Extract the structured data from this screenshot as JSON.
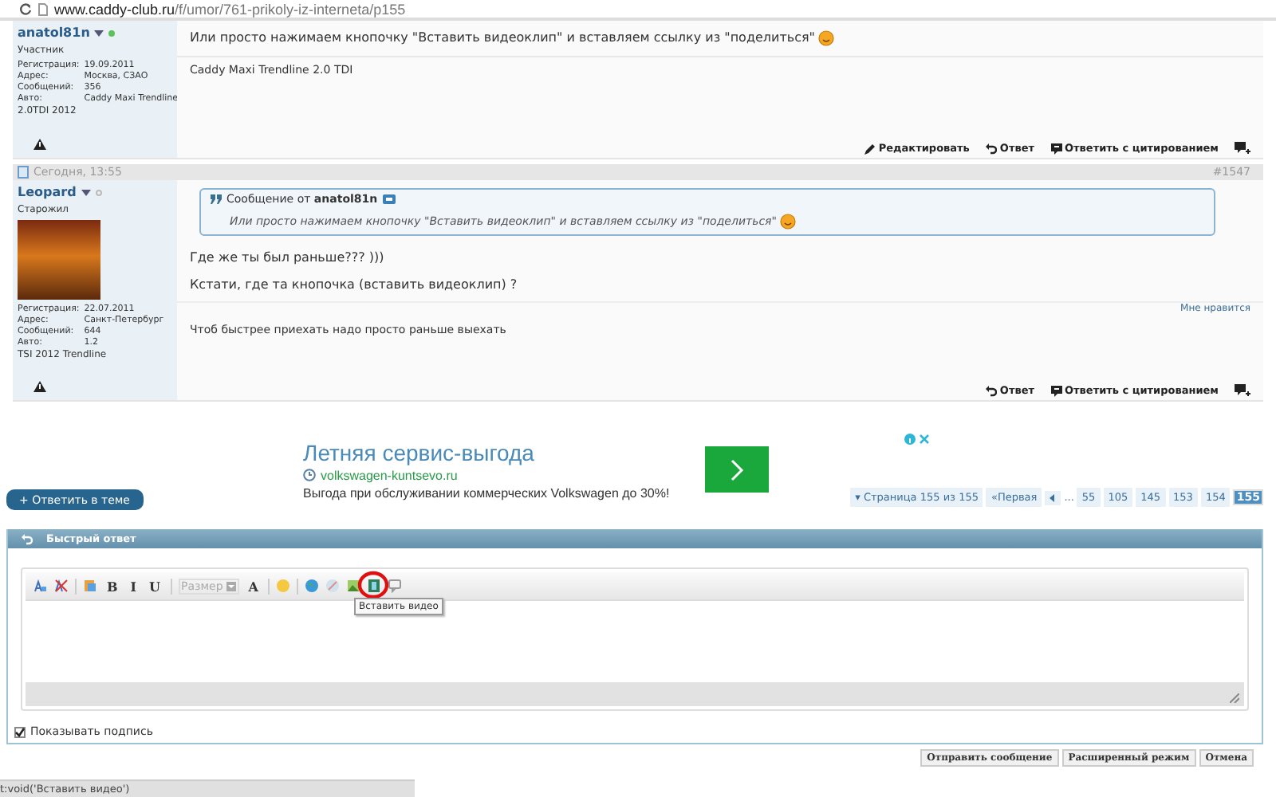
{
  "address_bar": {
    "domain": "www.caddy-club.ru",
    "path": "/f/umor/761-prikoly-iz-interneta/p155"
  },
  "posts": [
    {
      "user": {
        "name": "anatol81n",
        "online": true,
        "rank": "Участник",
        "has_avatar": false,
        "fields": [
          {
            "label": "Регистрация:",
            "value": "19.09.2011"
          },
          {
            "label": "Адрес:",
            "value": "Москва, СЗАО"
          },
          {
            "label": "Сообщений:",
            "value": "356"
          },
          {
            "label": "Авто:",
            "value": "Caddy Maxi Trendline"
          }
        ],
        "extra": "2.0TDI 2012"
      },
      "paragraphs": [
        "Или просто нажимаем кнопочку \"Вставить видеоклип\" и вставляем ссылку из \"поделиться\""
      ],
      "smiley": true,
      "signature": "Caddy Maxi Trendline 2.0 TDI",
      "actions": [
        {
          "kind": "edit",
          "label": "Редактировать"
        },
        {
          "kind": "reply",
          "label": "Ответ"
        },
        {
          "kind": "quote",
          "label": "Ответить с цитированием"
        }
      ]
    },
    {
      "date": "Сегодня, 13:55",
      "number": "#1547",
      "user": {
        "name": "Leopard",
        "online": false,
        "rank": "Старожил",
        "has_avatar": true,
        "fields": [
          {
            "label": "Регистрация:",
            "value": "22.07.2011"
          },
          {
            "label": "Адрес:",
            "value": "Санкт-Петербург"
          },
          {
            "label": "Сообщений:",
            "value": "644"
          },
          {
            "label": "Авто:",
            "value": "1.2"
          }
        ],
        "extra": "TSI 2012 Trendline"
      },
      "quote": {
        "prefix": "Сообщение от",
        "author": "anatol81n",
        "text": "Или просто нажимаем кнопочку \"Вставить видеоклип\" и вставляем ссылку из \"поделиться\""
      },
      "paragraphs": [
        "Где же ты был раньше??? )))",
        "Кстати, где та кнопочка (вставить видеоклип) ?"
      ],
      "smiley": false,
      "like": "Мне нравится",
      "signature": "Чтоб быстрее приехать надо просто раньше выехать",
      "actions": [
        {
          "kind": "reply",
          "label": "Ответ"
        },
        {
          "kind": "quote",
          "label": "Ответить с цитированием"
        }
      ]
    }
  ],
  "ad": {
    "title": "Летняя сервис-выгода",
    "url": "volkswagen-kuntsevo.ru",
    "description": "Выгода при обслуживании коммерческих Volkswagen до 30%!"
  },
  "reply_button": "+ Ответить в теме",
  "pagination": {
    "summary": "▾ Страница 155 из 155",
    "first": "«Первая",
    "ellipsis": "...",
    "pages": [
      {
        "label": "55",
        "selected": false
      },
      {
        "label": "105",
        "selected": false
      },
      {
        "label": "145",
        "selected": false
      },
      {
        "label": "153",
        "selected": false
      },
      {
        "label": "154",
        "selected": false
      },
      {
        "label": "155",
        "selected": true
      }
    ]
  },
  "quick_reply": {
    "title": "Быстрый ответ",
    "toolbar": [
      {
        "kind": "font"
      },
      {
        "kind": "clear"
      },
      {
        "kind": "sep"
      },
      {
        "kind": "paste"
      },
      {
        "kind": "text",
        "label": "B"
      },
      {
        "kind": "text",
        "label": "I"
      },
      {
        "kind": "text",
        "label": "U"
      },
      {
        "kind": "sep"
      },
      {
        "kind": "select",
        "label": "Размер"
      },
      {
        "kind": "text",
        "label": "A"
      },
      {
        "kind": "sep"
      },
      {
        "kind": "smiley"
      },
      {
        "kind": "sep"
      },
      {
        "kind": "globe"
      },
      {
        "kind": "unlink"
      },
      {
        "kind": "image"
      },
      {
        "kind": "video",
        "highlighted": true
      },
      {
        "kind": "quote"
      }
    ],
    "tooltip": "Вставить видео",
    "show_signature": {
      "label": "Показывать подпись",
      "checked": true
    }
  },
  "buttons": [
    "Отправить сообщение",
    "Расширенный режим",
    "Отмена"
  ],
  "status_bar": "t:void('Вставить видео')"
}
